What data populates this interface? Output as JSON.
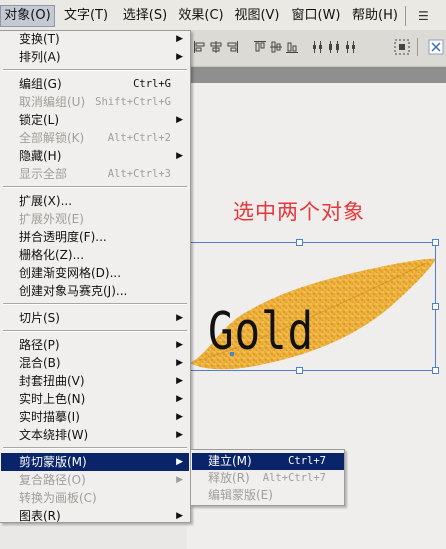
{
  "menubar": {
    "items": [
      {
        "label": "对象(O)"
      },
      {
        "label": "文字(T)"
      },
      {
        "label": "选择(S)"
      },
      {
        "label": "效果(C)"
      },
      {
        "label": "视图(V)"
      },
      {
        "label": "窗口(W)"
      },
      {
        "label": "帮助(H)"
      }
    ]
  },
  "menu": {
    "items": [
      {
        "label": "变换(T)",
        "shortcut": "",
        "submenu": true,
        "disabled": false
      },
      {
        "label": "排列(A)",
        "shortcut": "",
        "submenu": true,
        "disabled": false
      },
      {
        "label": "编组(G)",
        "shortcut": "Ctrl+G",
        "submenu": false,
        "disabled": false
      },
      {
        "label": "取消编组(U)",
        "shortcut": "Shift+Ctrl+G",
        "submenu": false,
        "disabled": true
      },
      {
        "label": "锁定(L)",
        "shortcut": "",
        "submenu": true,
        "disabled": false
      },
      {
        "label": "全部解锁(K)",
        "shortcut": "Alt+Ctrl+2",
        "submenu": false,
        "disabled": true
      },
      {
        "label": "隐藏(H)",
        "shortcut": "",
        "submenu": true,
        "disabled": false
      },
      {
        "label": "显示全部",
        "shortcut": "Alt+Ctrl+3",
        "submenu": false,
        "disabled": true
      },
      {
        "label": "扩展(X)...",
        "shortcut": "",
        "submenu": false,
        "disabled": false
      },
      {
        "label": "扩展外观(E)",
        "shortcut": "",
        "submenu": false,
        "disabled": true
      },
      {
        "label": "拼合透明度(F)...",
        "shortcut": "",
        "submenu": false,
        "disabled": false
      },
      {
        "label": "栅格化(Z)...",
        "shortcut": "",
        "submenu": false,
        "disabled": false
      },
      {
        "label": "创建渐变网格(D)...",
        "shortcut": "",
        "submenu": false,
        "disabled": false
      },
      {
        "label": "创建对象马赛克(J)...",
        "shortcut": "",
        "submenu": false,
        "disabled": false
      },
      {
        "label": "切片(S)",
        "shortcut": "",
        "submenu": true,
        "disabled": false
      },
      {
        "label": "路径(P)",
        "shortcut": "",
        "submenu": true,
        "disabled": false
      },
      {
        "label": "混合(B)",
        "shortcut": "",
        "submenu": true,
        "disabled": false
      },
      {
        "label": "封套扭曲(V)",
        "shortcut": "",
        "submenu": true,
        "disabled": false
      },
      {
        "label": "实时上色(N)",
        "shortcut": "",
        "submenu": true,
        "disabled": false
      },
      {
        "label": "实时描摹(I)",
        "shortcut": "",
        "submenu": true,
        "disabled": false
      },
      {
        "label": "文本绕排(W)",
        "shortcut": "",
        "submenu": true,
        "disabled": false
      },
      {
        "label": "剪切蒙版(M)",
        "shortcut": "",
        "submenu": true,
        "disabled": false,
        "highlighted": true
      },
      {
        "label": "复合路径(O)",
        "shortcut": "",
        "submenu": true,
        "disabled": true
      },
      {
        "label": "转换为画板(C)",
        "shortcut": "",
        "submenu": false,
        "disabled": true
      },
      {
        "label": "图表(R)",
        "shortcut": "",
        "submenu": true,
        "disabled": false
      }
    ]
  },
  "submenu": {
    "items": [
      {
        "label": "建立(M)",
        "shortcut": "Ctrl+7",
        "disabled": false,
        "highlighted": true
      },
      {
        "label": "释放(R)",
        "shortcut": "Alt+Ctrl+7",
        "disabled": true
      },
      {
        "label": "编辑蒙版(E)",
        "shortcut": "",
        "disabled": true
      }
    ]
  },
  "canvas": {
    "caption": "选中两个对象",
    "artwork_text": "Gold"
  },
  "colors": {
    "menu_highlight": "#0a246a",
    "selection_blue": "#4f7fce",
    "caption_red": "#e5383c",
    "leaf_gold": "#e3a52c"
  },
  "icons": {
    "submenu_arrow": "triangle-right-icon",
    "toolbar": [
      "align-left-icon",
      "align-center-icon",
      "align-right-icon",
      "distribute-top-icon",
      "distribute-vcenter-icon",
      "distribute-bottom-icon",
      "distribute-left-icon",
      "distribute-hcenter-icon",
      "distribute-right-icon",
      "align-to-selection-icon",
      "align-to-artboard-icon"
    ]
  }
}
